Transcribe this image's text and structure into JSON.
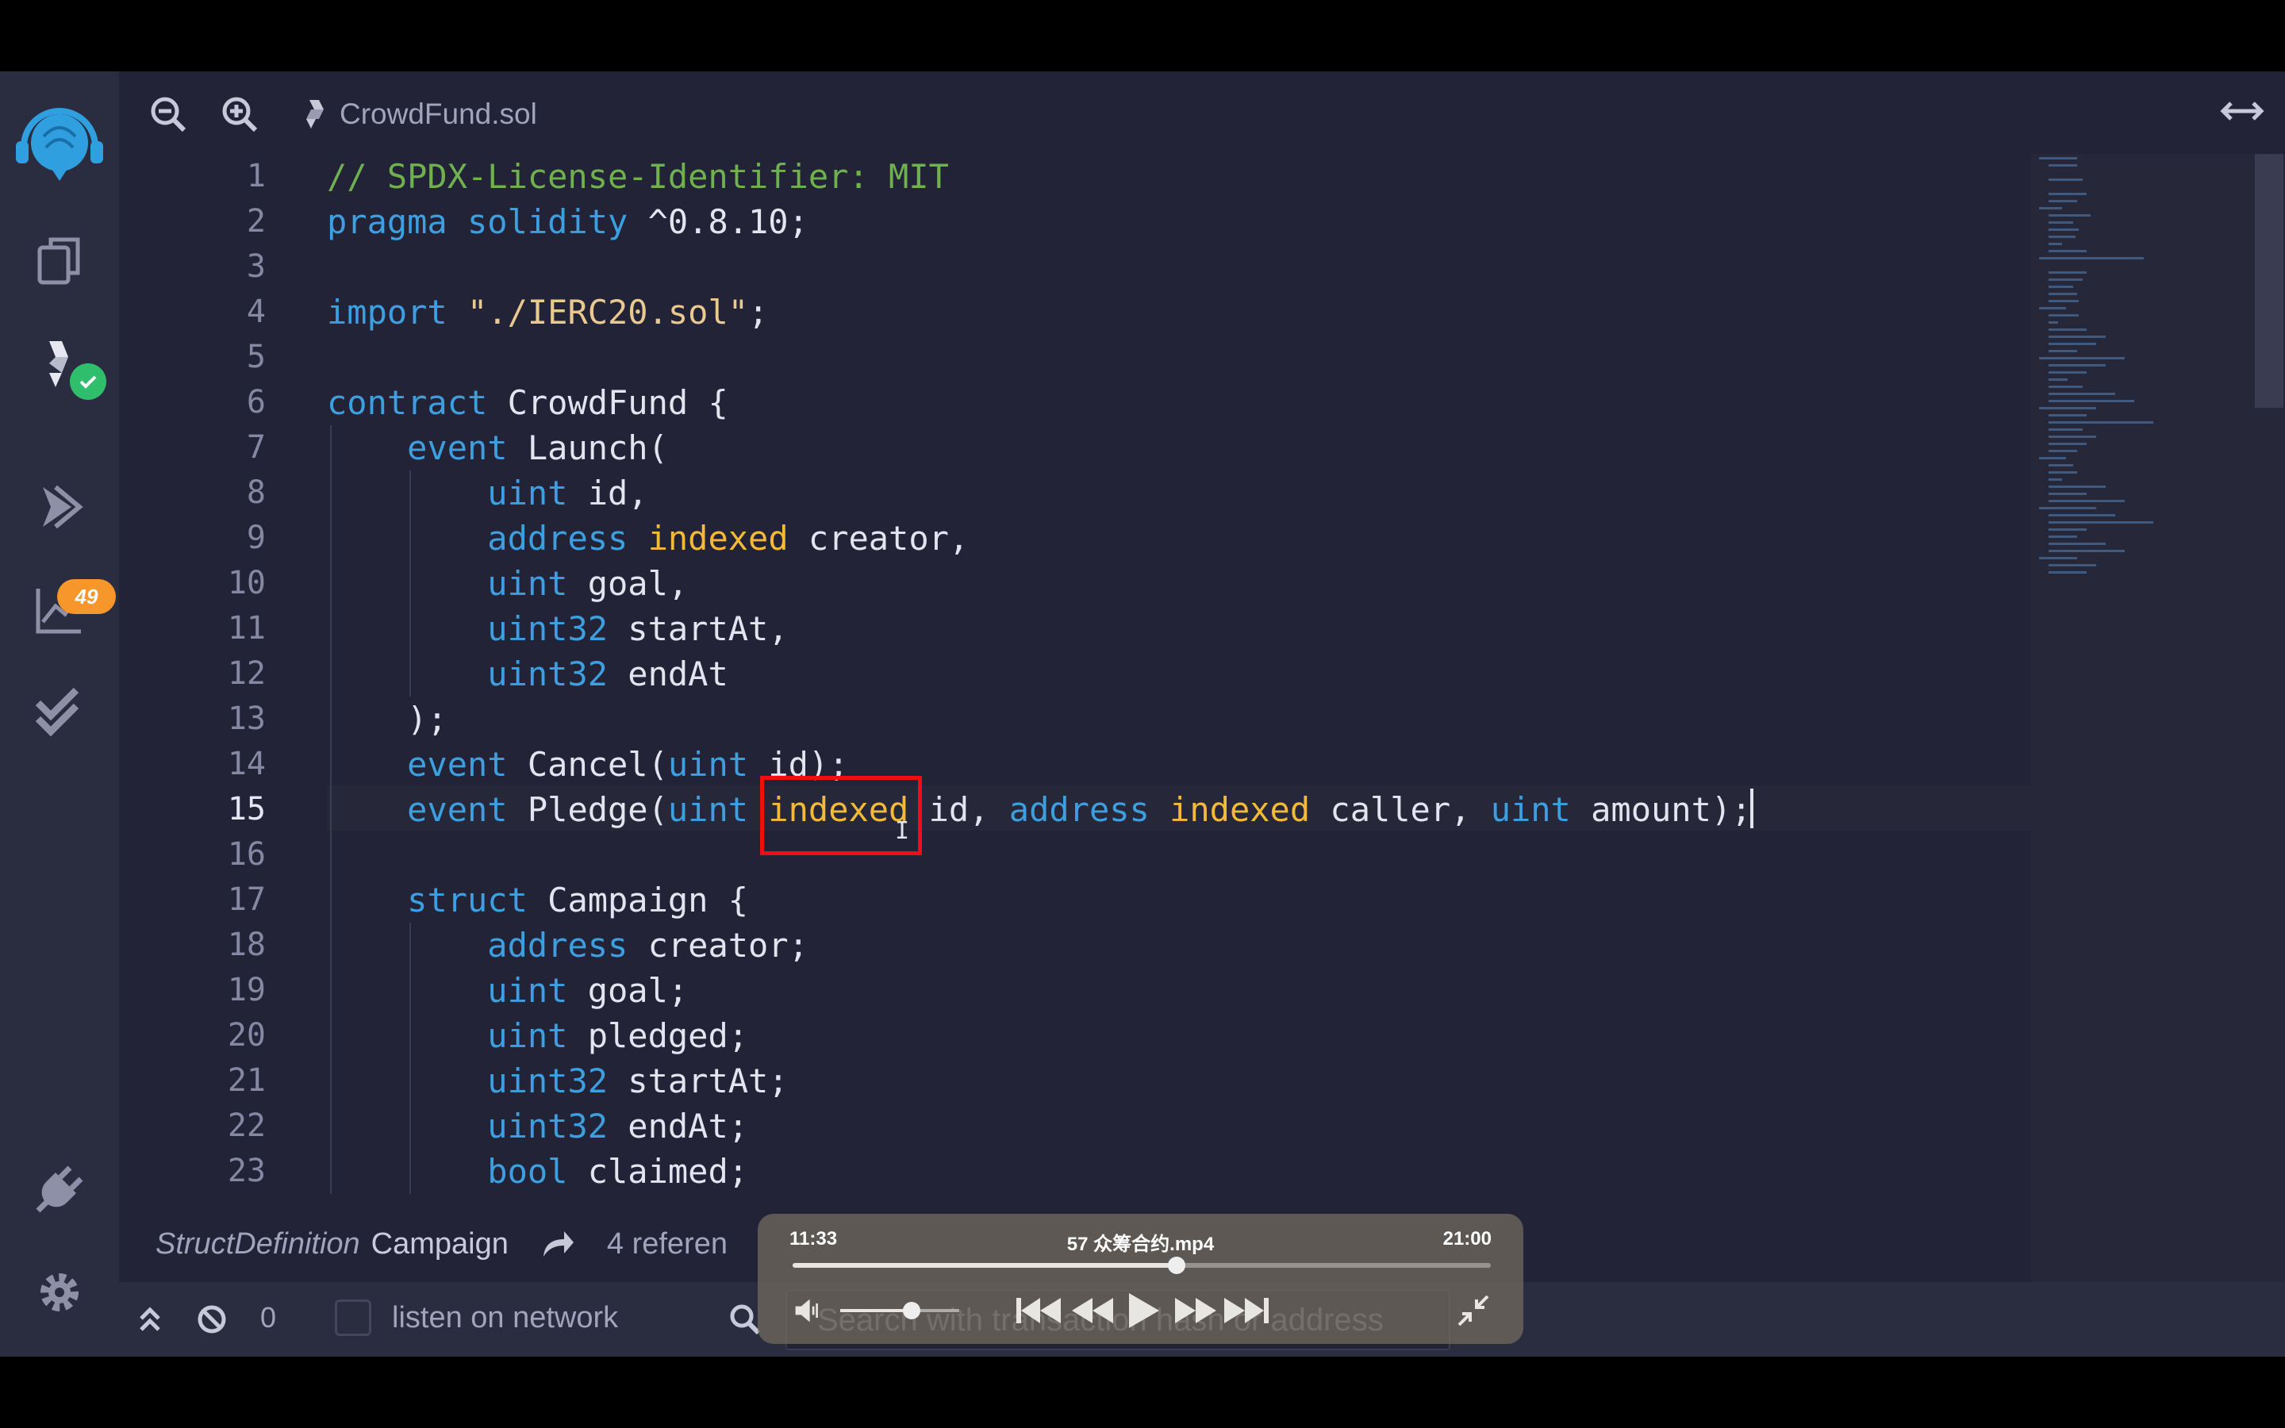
{
  "tab": {
    "filename": "CrowdFund.sol"
  },
  "sidebar": {
    "analysis_badge": "49"
  },
  "editor": {
    "line_numbers": [
      "1",
      "2",
      "3",
      "4",
      "5",
      "6",
      "7",
      "8",
      "9",
      "10",
      "11",
      "12",
      "13",
      "14",
      "15",
      "16",
      "17",
      "18",
      "19",
      "20",
      "21",
      "22",
      "23"
    ],
    "active_line": 15,
    "lines": [
      [
        {
          "t": "// SPDX-License-Identifier: MIT",
          "c": "cm"
        }
      ],
      [
        {
          "t": "pragma solidity",
          "c": "kw"
        },
        {
          "t": " ^0.8.10;",
          "c": ""
        }
      ],
      [],
      [
        {
          "t": "import",
          "c": "kw"
        },
        {
          "t": " ",
          "c": ""
        },
        {
          "t": "\"./IERC20.sol\"",
          "c": "st"
        },
        {
          "t": ";",
          "c": ""
        }
      ],
      [],
      [
        {
          "t": "contract",
          "c": "kw"
        },
        {
          "t": " CrowdFund {",
          "c": ""
        }
      ],
      [
        {
          "t": "    ",
          "c": ""
        },
        {
          "t": "event",
          "c": "kw"
        },
        {
          "t": " Launch(",
          "c": ""
        }
      ],
      [
        {
          "t": "        ",
          "c": ""
        },
        {
          "t": "uint",
          "c": "kw"
        },
        {
          "t": " id,",
          "c": ""
        }
      ],
      [
        {
          "t": "        ",
          "c": ""
        },
        {
          "t": "address",
          "c": "kw"
        },
        {
          "t": " ",
          "c": ""
        },
        {
          "t": "indexed",
          "c": "ix"
        },
        {
          "t": " creator,",
          "c": ""
        }
      ],
      [
        {
          "t": "        ",
          "c": ""
        },
        {
          "t": "uint",
          "c": "kw"
        },
        {
          "t": " goal,",
          "c": ""
        }
      ],
      [
        {
          "t": "        ",
          "c": ""
        },
        {
          "t": "uint32",
          "c": "kw"
        },
        {
          "t": " startAt,",
          "c": ""
        }
      ],
      [
        {
          "t": "        ",
          "c": ""
        },
        {
          "t": "uint32",
          "c": "kw"
        },
        {
          "t": " endAt",
          "c": ""
        }
      ],
      [
        {
          "t": "    );",
          "c": ""
        }
      ],
      [
        {
          "t": "    ",
          "c": ""
        },
        {
          "t": "event",
          "c": "kw"
        },
        {
          "t": " Cancel(",
          "c": ""
        },
        {
          "t": "uint",
          "c": "kw"
        },
        {
          "t": " id);",
          "c": ""
        }
      ],
      [
        {
          "t": "    ",
          "c": ""
        },
        {
          "t": "event",
          "c": "kw"
        },
        {
          "t": " Pledge(",
          "c": ""
        },
        {
          "t": "uint",
          "c": "kw"
        },
        {
          "t": " ",
          "c": ""
        },
        {
          "t": "indexed",
          "c": "ix"
        },
        {
          "t": " id, ",
          "c": ""
        },
        {
          "t": "address",
          "c": "kw"
        },
        {
          "t": " ",
          "c": ""
        },
        {
          "t": "indexed",
          "c": "ix"
        },
        {
          "t": " caller, ",
          "c": ""
        },
        {
          "t": "uint",
          "c": "kw"
        },
        {
          "t": " amount);",
          "c": ""
        }
      ],
      [],
      [
        {
          "t": "    ",
          "c": ""
        },
        {
          "t": "struct",
          "c": "kw"
        },
        {
          "t": " Campaign {",
          "c": ""
        }
      ],
      [
        {
          "t": "        ",
          "c": ""
        },
        {
          "t": "address",
          "c": "kw"
        },
        {
          "t": " creator;",
          "c": ""
        }
      ],
      [
        {
          "t": "        ",
          "c": ""
        },
        {
          "t": "uint",
          "c": "kw"
        },
        {
          "t": " goal;",
          "c": ""
        }
      ],
      [
        {
          "t": "        ",
          "c": ""
        },
        {
          "t": "uint",
          "c": "kw"
        },
        {
          "t": " pledged;",
          "c": ""
        }
      ],
      [
        {
          "t": "        ",
          "c": ""
        },
        {
          "t": "uint32",
          "c": "kw"
        },
        {
          "t": " startAt;",
          "c": ""
        }
      ],
      [
        {
          "t": "        ",
          "c": ""
        },
        {
          "t": "uint32",
          "c": "kw"
        },
        {
          "t": " endAt;",
          "c": ""
        }
      ],
      [
        {
          "t": "        ",
          "c": ""
        },
        {
          "t": "bool",
          "c": "kw"
        },
        {
          "t": " claimed;",
          "c": ""
        }
      ]
    ]
  },
  "definition_bar": {
    "kind": "StructDefinition",
    "name": "Campaign",
    "references": "4 referen"
  },
  "terminal": {
    "count": "0",
    "listen_label": "listen on network",
    "search_placeholder": "Search with transaction hash or address"
  },
  "player": {
    "elapsed": "11:33",
    "title": "57 众筹合约.mp4",
    "total": "21:00",
    "progress": 0.55,
    "volume": 0.6
  },
  "colors": {
    "keyword": "#3d9fe0",
    "indexed": "#f5b93a",
    "comment": "#6fb04f",
    "string": "#e9c98f",
    "highlight_box": "#ef0e12"
  }
}
